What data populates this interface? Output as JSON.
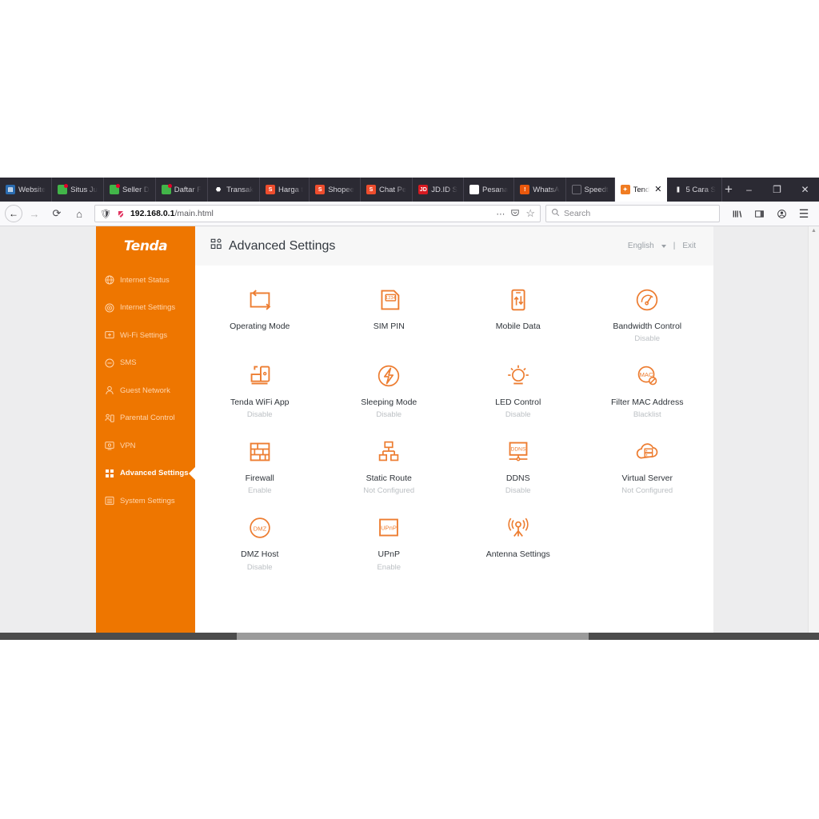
{
  "browser": {
    "tabs": [
      {
        "label": "Website",
        "icon": "website-favicon",
        "style": "fav-blue",
        "active": false
      },
      {
        "label": "Situs Ju",
        "icon": "tokopedia-favicon",
        "style": "fav-tokopedia",
        "active": false
      },
      {
        "label": "Seller D",
        "icon": "tokopedia-favicon",
        "style": "fav-tokopedia",
        "active": false
      },
      {
        "label": "Daftar F",
        "icon": "tokopedia-favicon",
        "style": "fav-tokopedia",
        "active": false
      },
      {
        "label": "Transak",
        "icon": "bukalapak-favicon",
        "style": "fav-bukalapak",
        "active": false
      },
      {
        "label": "Harga t",
        "icon": "shopee-favicon",
        "style": "fav-shopee",
        "active": false
      },
      {
        "label": "Shopee",
        "icon": "shopee-favicon",
        "style": "fav-shopee",
        "active": false
      },
      {
        "label": "Chat Pe",
        "icon": "shopee-favicon",
        "style": "fav-shopee",
        "active": false
      },
      {
        "label": "JD.ID S",
        "icon": "jdid-favicon",
        "style": "fav-jd",
        "active": false
      },
      {
        "label": "Pesana",
        "icon": "document-favicon",
        "style": "fav-doc",
        "active": false
      },
      {
        "label": "WhatsA",
        "icon": "whatsapp-favicon",
        "style": "fav-wa",
        "active": false
      },
      {
        "label": "Speedt",
        "icon": "speedtest-favicon",
        "style": "fav-gray",
        "active": false
      },
      {
        "label": "Tend",
        "icon": "tenda-favicon",
        "style": "fav-tenda",
        "active": true
      },
      {
        "label": "5 Cara S",
        "icon": "article-favicon",
        "style": "fav-red3",
        "active": false
      }
    ],
    "new_tab_label": "+",
    "window_controls": {
      "minimize": "–",
      "maximize": "❐",
      "close": "✕"
    },
    "close_tab_label": "✕",
    "nav": {
      "back": "←",
      "forward": "→",
      "reload": "⟳",
      "home": "⌂",
      "url_host": "192.168.0.1",
      "url_path": "/main.html",
      "shield_icon": "shield-icon",
      "tracking_icon": "tracking-protection-off-icon",
      "more_icon": "⋯",
      "pocket_icon": "pocket-icon",
      "bookmark_icon": "☆",
      "search_placeholder": "Search",
      "search_icon": "search-icon",
      "library_icon": "library-icon",
      "sidebar_icon": "sidebar-icon",
      "account_icon": "account-icon",
      "menu_icon": "☰"
    }
  },
  "router": {
    "brand": "Tenda",
    "sidebar": [
      {
        "label": "Internet Status",
        "icon": "globe-icon",
        "active": false
      },
      {
        "label": "Internet Settings",
        "icon": "signal-icon",
        "active": false
      },
      {
        "label": "Wi-Fi Settings",
        "icon": "wifi-icon",
        "active": false
      },
      {
        "label": "SMS",
        "icon": "message-icon",
        "active": false
      },
      {
        "label": "Guest Network",
        "icon": "user-icon",
        "active": false
      },
      {
        "label": "Parental Control",
        "icon": "parental-icon",
        "active": false
      },
      {
        "label": "VPN",
        "icon": "vpn-icon",
        "active": false
      },
      {
        "label": "Advanced Settings",
        "icon": "grid-icon",
        "active": true
      },
      {
        "label": "System Settings",
        "icon": "list-icon",
        "active": false
      }
    ],
    "header": {
      "title": "Advanced Settings",
      "title_icon": "grid-icon",
      "language": "English",
      "divider": "|",
      "exit": "Exit"
    },
    "tiles": [
      {
        "label": "Operating Mode",
        "state": "",
        "icon": "operating-mode-icon"
      },
      {
        "label": "SIM PIN",
        "state": "",
        "icon": "sim-pin-icon"
      },
      {
        "label": "Mobile Data",
        "state": "",
        "icon": "mobile-data-icon"
      },
      {
        "label": "Bandwidth Control",
        "state": "Disable",
        "icon": "bandwidth-control-icon"
      },
      {
        "label": "Tenda WiFi App",
        "state": "Disable",
        "icon": "tenda-wifi-app-icon"
      },
      {
        "label": "Sleeping Mode",
        "state": "Disable",
        "icon": "sleeping-mode-icon"
      },
      {
        "label": "LED Control",
        "state": "Disable",
        "icon": "led-control-icon"
      },
      {
        "label": "Filter MAC Address",
        "state": "Blacklist",
        "icon": "filter-mac-address-icon"
      },
      {
        "label": "Firewall",
        "state": "Enable",
        "icon": "firewall-icon"
      },
      {
        "label": "Static Route",
        "state": "Not Configured",
        "icon": "static-route-icon"
      },
      {
        "label": "DDNS",
        "state": "Disable",
        "icon": "ddns-icon"
      },
      {
        "label": "Virtual Server",
        "state": "Not Configured",
        "icon": "virtual-server-icon"
      },
      {
        "label": "DMZ Host",
        "state": "Disable",
        "icon": "dmz-host-icon"
      },
      {
        "label": "UPnP",
        "state": "Enable",
        "icon": "upnp-icon"
      },
      {
        "label": "Antenna Settings",
        "state": "",
        "icon": "antenna-settings-icon"
      }
    ],
    "icon_text": {
      "sim": "1234",
      "mac": "MAC",
      "ddns": "DDNS",
      "dmz": "DMZ",
      "upnp": "UPnP"
    },
    "colors": {
      "brand_orange": "#ee7600",
      "icon_orange": "#ed7d31",
      "text_dark": "#2f343a",
      "state_gray": "#bcc0c4"
    }
  }
}
